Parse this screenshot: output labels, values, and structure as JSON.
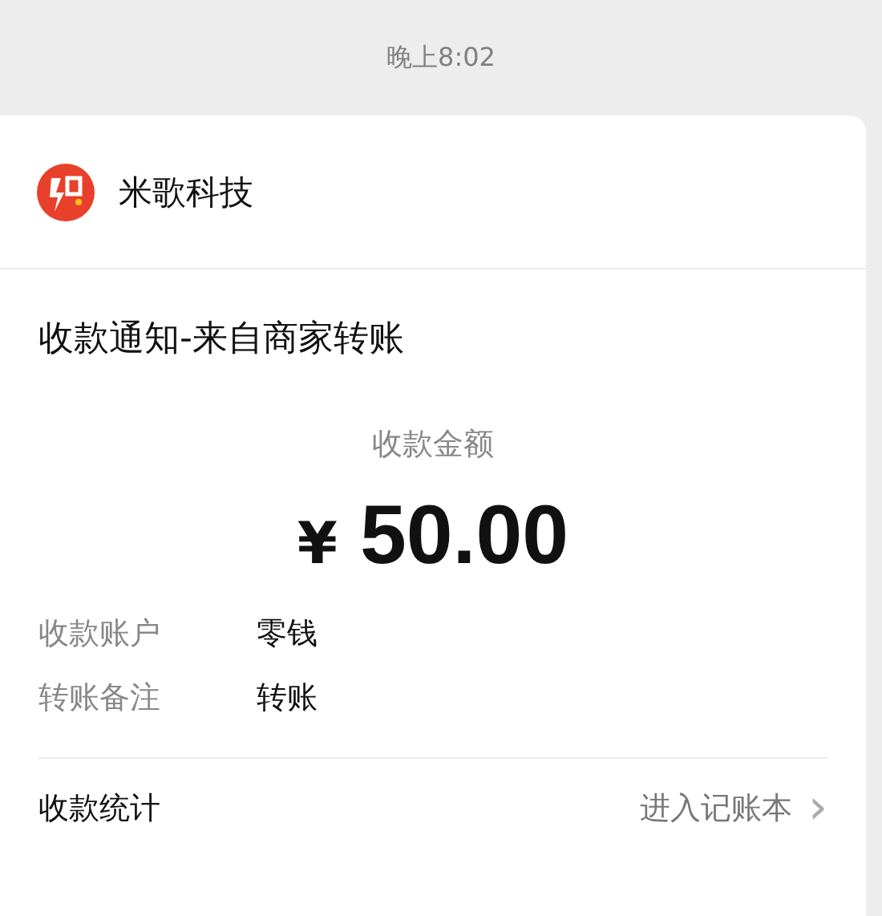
{
  "time": "晚上8:02",
  "merchant": {
    "name": "米歌科技"
  },
  "title": "收款通知-来自商家转账",
  "amount": {
    "label": "收款金额",
    "currency": "¥",
    "value": "50.00"
  },
  "details": [
    {
      "label": "收款账户",
      "value": "零钱"
    },
    {
      "label": "转账备注",
      "value": "转账"
    }
  ],
  "footer": {
    "label": "收款统计",
    "link": "进入记账本",
    "chevron": "›"
  }
}
